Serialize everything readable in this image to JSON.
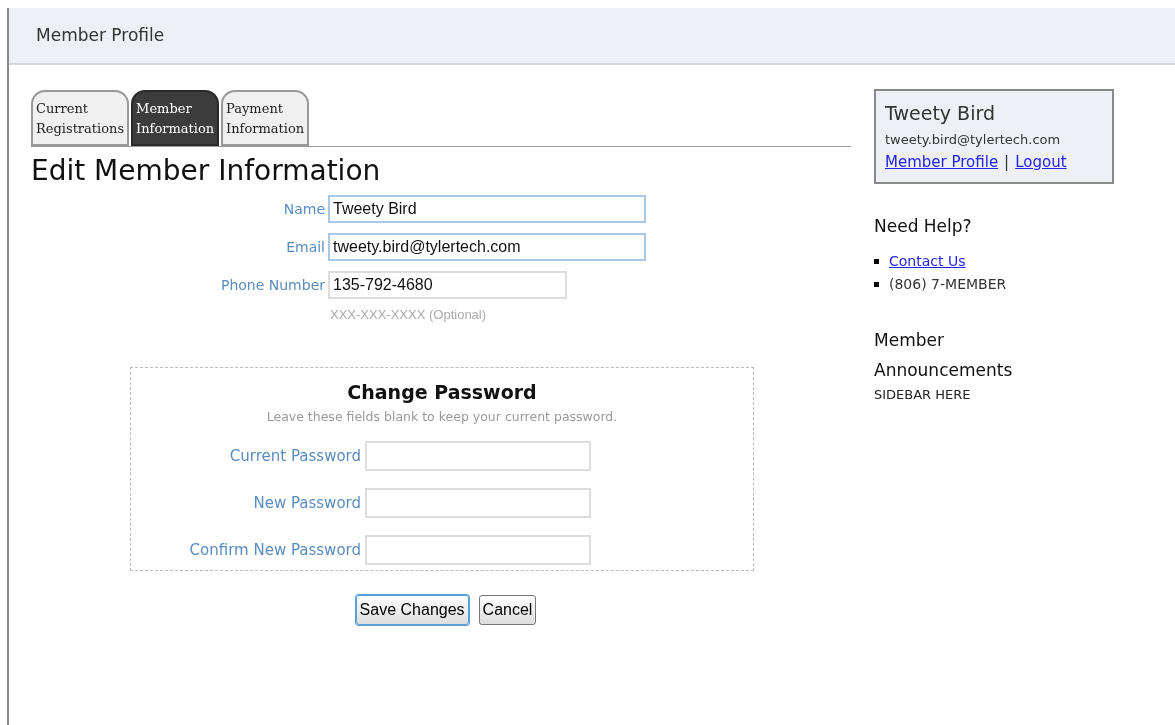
{
  "header": {
    "title": "Member Profile"
  },
  "tabs": [
    {
      "label": [
        "Current",
        "Registrations"
      ],
      "selected": false
    },
    {
      "label": [
        "Member",
        "Information"
      ],
      "selected": true
    },
    {
      "label": [
        "Payment",
        "Information"
      ],
      "selected": false
    }
  ],
  "heading": "Edit Member Information",
  "fields": [
    {
      "label": "Name",
      "value": "Tweety Bird",
      "wide": true
    },
    {
      "label": "Email",
      "value": "tweety.bird@tylertech.com",
      "wide": true
    },
    {
      "label": "Phone Number",
      "value": "135-792-4680",
      "wide": false,
      "hint": "XXX-XXX-XXXX (Optional)"
    }
  ],
  "password": {
    "title": "Change Password",
    "note": "Leave these fields blank to keep your current password.",
    "fields": [
      {
        "label": "Current Password"
      },
      {
        "label": "New Password"
      },
      {
        "label": "Confirm New Password"
      }
    ]
  },
  "buttons": [
    {
      "label": "Save Changes",
      "focused": true
    },
    {
      "label": "Cancel",
      "focused": false
    }
  ],
  "sidebar": {
    "user": {
      "name": "Tweety Bird",
      "email": "tweety.bird@tylertech.com",
      "links": [
        "Member Profile",
        "Logout"
      ],
      "separator": "|"
    },
    "help": {
      "title": "Need Help?",
      "items": [
        {
          "kind": "link",
          "text": "Contact Us"
        },
        {
          "kind": "text",
          "text": "(806) 7-MEMBER"
        }
      ]
    },
    "announcements": {
      "title": "Member Announcements",
      "text": "SIDEBAR HERE"
    }
  }
}
